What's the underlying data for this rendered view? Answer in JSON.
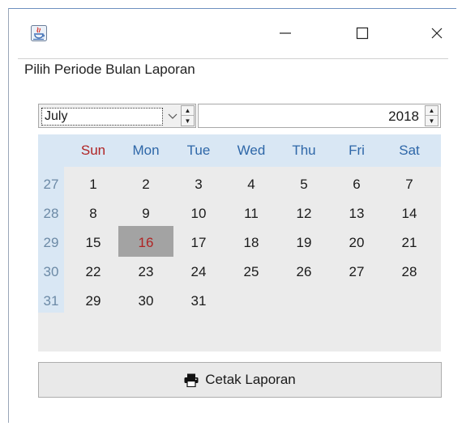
{
  "window": {
    "icon": "java-icon",
    "controls": {
      "minimize": "—",
      "maximize": "☐",
      "close": "✕"
    }
  },
  "panel": {
    "legend": "Pilih Periode Bulan Laporan"
  },
  "month_selector": {
    "value": "July",
    "chevron": "⌄",
    "up": "▲",
    "down": "▼"
  },
  "year_selector": {
    "value": "2018",
    "up": "▲",
    "down": "▼"
  },
  "calendar": {
    "weekdays": [
      "Sun",
      "Mon",
      "Tue",
      "Wed",
      "Thu",
      "Fri",
      "Sat"
    ],
    "weeks": [
      {
        "number": "27",
        "days": [
          "1",
          "2",
          "3",
          "4",
          "5",
          "6",
          "7"
        ]
      },
      {
        "number": "28",
        "days": [
          "8",
          "9",
          "10",
          "11",
          "12",
          "13",
          "14"
        ]
      },
      {
        "number": "29",
        "days": [
          "15",
          "16",
          "17",
          "18",
          "19",
          "20",
          "21"
        ]
      },
      {
        "number": "30",
        "days": [
          "22",
          "23",
          "24",
          "25",
          "26",
          "27",
          "28"
        ]
      },
      {
        "number": "31",
        "days": [
          "29",
          "30",
          "31",
          "",
          "",
          "",
          ""
        ]
      }
    ],
    "selected_day": "16",
    "colors": {
      "header_bg": "#d9e7f4",
      "weekday_text": "#2e67a8",
      "sunday_text": "#b02424",
      "selected_bg": "#a3a3a3"
    }
  },
  "action": {
    "print_label": "Cetak Laporan",
    "print_icon": "printer-icon"
  }
}
